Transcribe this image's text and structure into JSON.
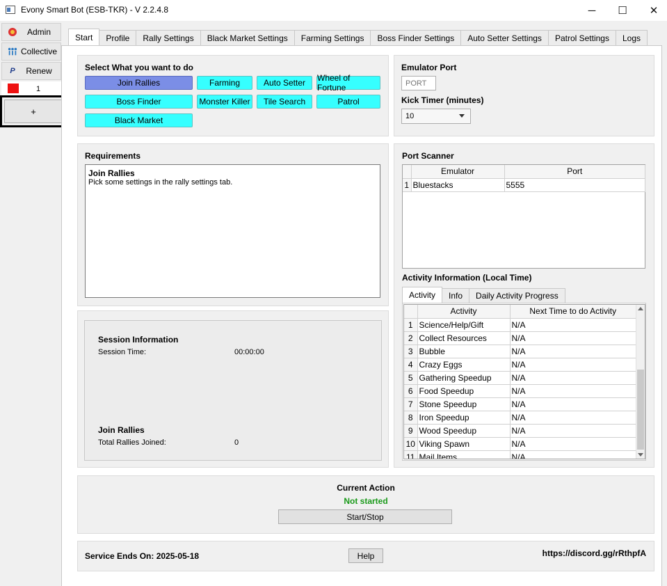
{
  "window": {
    "title": "Evony Smart Bot (ESB-TKR) - V 2.2.4.8",
    "minimize": "─",
    "maximize": "☐",
    "close": "✕"
  },
  "sidebar": {
    "items": [
      {
        "label": "Admin",
        "icon": "admin-icon"
      },
      {
        "label": "Collective",
        "icon": "collective-icon"
      },
      {
        "label": "Renew",
        "icon": "paypal-icon"
      }
    ],
    "account": {
      "number": "1",
      "color": "#ee1111"
    },
    "add_label": "+"
  },
  "tabs": [
    "Start",
    "Profile",
    "Rally Settings",
    "Black Market Settings",
    "Farming Settings",
    "Boss Finder Settings",
    "Auto Setter Settings",
    "Patrol Settings",
    "Logs"
  ],
  "select_tasks": {
    "title": "Select What you want to do",
    "buttons": [
      "Join Rallies",
      "Farming",
      "Auto Setter",
      "Wheel of Fortune",
      "Boss Finder",
      "Monster Killer",
      "Tile Search",
      "Patrol",
      "Black Market"
    ],
    "selected": "Join Rallies"
  },
  "emulator": {
    "port_title": "Emulator Port",
    "port_placeholder": "PORT",
    "kick_title": "Kick Timer (minutes)",
    "kick_value": "10"
  },
  "requirements": {
    "title": "Requirements",
    "heading": "Join Rallies",
    "text": "Pick some settings in the rally settings tab."
  },
  "port_scanner": {
    "title": "Port Scanner",
    "columns": [
      "Emulator",
      "Port"
    ],
    "rows": [
      {
        "num": "1",
        "emulator": "Bluestacks",
        "port": "5555"
      }
    ]
  },
  "session": {
    "title": "Session Information",
    "time_label": "Session Time:",
    "time_value": "00:00:00",
    "rallies_title": "Join Rallies",
    "rallies_label": "Total Rallies Joined:",
    "rallies_value": "0"
  },
  "activity": {
    "title": "Activity Information (Local Time)",
    "tabs": [
      "Activity",
      "Info",
      "Daily Activity Progress"
    ],
    "columns": [
      "Activity",
      "Next Time to do Activity"
    ],
    "rows": [
      {
        "num": "1",
        "name": "Science/Help/Gift",
        "next": "N/A"
      },
      {
        "num": "2",
        "name": "Collect Resources",
        "next": "N/A"
      },
      {
        "num": "3",
        "name": "Bubble",
        "next": "N/A"
      },
      {
        "num": "4",
        "name": "Crazy Eggs",
        "next": "N/A"
      },
      {
        "num": "5",
        "name": "Gathering Speedup",
        "next": "N/A"
      },
      {
        "num": "6",
        "name": "Food Speedup",
        "next": "N/A"
      },
      {
        "num": "7",
        "name": "Stone Speedup",
        "next": "N/A"
      },
      {
        "num": "8",
        "name": "Iron Speedup",
        "next": "N/A"
      },
      {
        "num": "9",
        "name": "Wood Speedup",
        "next": "N/A"
      },
      {
        "num": "10",
        "name": "Viking Spawn",
        "next": "N/A"
      },
      {
        "num": "11",
        "name": "Mail Items",
        "next": "N/A"
      }
    ]
  },
  "current_action": {
    "title": "Current Action",
    "status": "Not started",
    "status_color": "#1a9a1a",
    "button": "Start/Stop"
  },
  "footer": {
    "service_ends": "Service Ends On: 2025-05-18",
    "help": "Help",
    "discord": "https://discord.gg/rRthpfA"
  }
}
